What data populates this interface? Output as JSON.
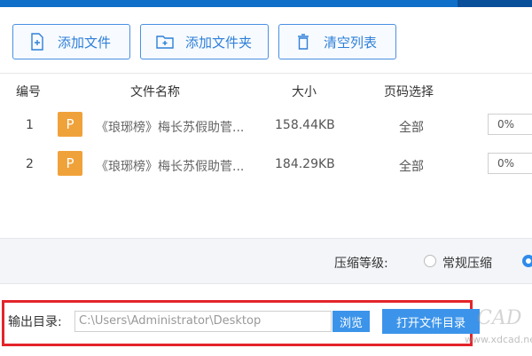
{
  "toolbar": {
    "add_file": "添加文件",
    "add_folder": "添加文件夹",
    "clear_list": "清空列表"
  },
  "table": {
    "columns": [
      "编号",
      "文件名称",
      "大小",
      "页码选择"
    ],
    "rows": [
      {
        "index": "1",
        "badge": "P",
        "name": "《琅琊榜》梅长苏假助菅...",
        "size": "158.44KB",
        "pages": "全部",
        "progress": "0%"
      },
      {
        "index": "2",
        "badge": "P",
        "name": "《琅琊榜》梅长苏假助菅...",
        "size": "184.29KB",
        "pages": "全部",
        "progress": "0%"
      }
    ]
  },
  "compression": {
    "label": "压缩等级:",
    "options": [
      "常规压缩"
    ]
  },
  "output": {
    "label": "输出目录:",
    "path": "C:\\Users\\Administrator\\Desktop",
    "browse": "浏览",
    "open_dir": "打开文件目录"
  },
  "watermark": {
    "logo": "CAD",
    "url": "www.xdcad.net"
  },
  "colors": {
    "accent": "#3c94ea",
    "highlight_box": "#e3242b",
    "file_badge": "#f0a23a"
  }
}
